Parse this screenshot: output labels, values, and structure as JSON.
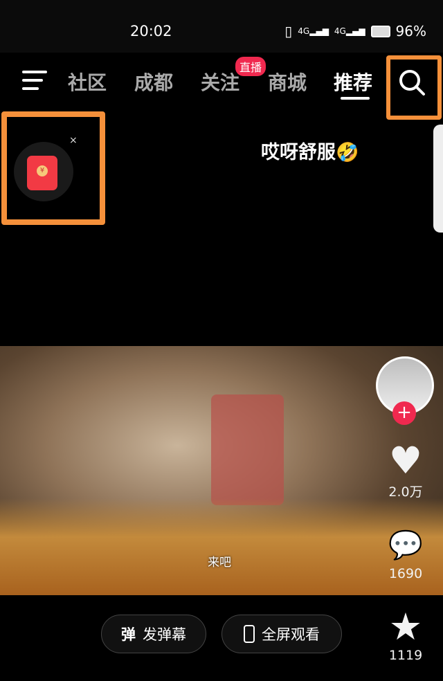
{
  "status": {
    "time": "20:02",
    "network": "4G",
    "battery": "96%"
  },
  "nav": {
    "tabs": [
      {
        "label": "社区"
      },
      {
        "label": "成都"
      },
      {
        "label": "关注"
      },
      {
        "label": "商城"
      },
      {
        "label": "推荐",
        "active": true
      }
    ],
    "live_badge": "直播"
  },
  "red_packet": {
    "close": "×",
    "coin": "¥"
  },
  "video": {
    "caption": "哎呀舒服🤣",
    "subtitle": "来吧"
  },
  "actions": {
    "likes": "2.0万",
    "comments": "1690",
    "favorites": "1119",
    "follow": "+"
  },
  "bottom": {
    "danmaku_icon": "弹",
    "danmaku_label": "发弹幕",
    "fullscreen_label": "全屏观看"
  },
  "colors": {
    "accent": "#f0294f",
    "highlight": "#f5903a"
  }
}
